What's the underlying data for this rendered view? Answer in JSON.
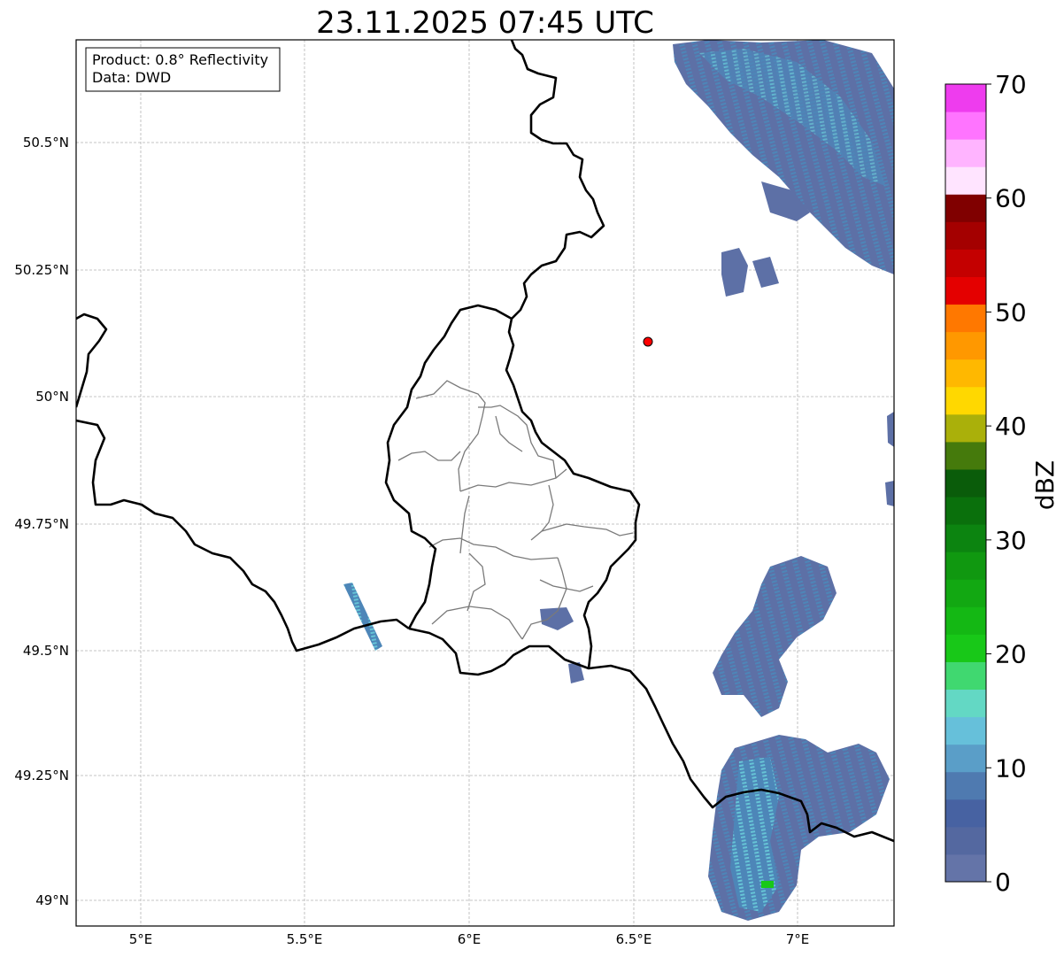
{
  "title": "23.11.2025 07:45 UTC",
  "info_box": {
    "product": "Product: 0.8° Reflectivity",
    "data": "Data: DWD"
  },
  "axes": {
    "lon_ticks": [
      "5°E",
      "5.5°E",
      "6°E",
      "6.5°E",
      "7°E"
    ],
    "lat_ticks": [
      "50.5°N",
      "50.25°N",
      "50°N",
      "49.75°N",
      "49.5°N",
      "49.25°N",
      "49°N"
    ]
  },
  "colorbar": {
    "label": "dBZ",
    "ticks": [
      "0",
      "10",
      "20",
      "30",
      "40",
      "50",
      "60",
      "70"
    ],
    "colors": [
      "#6474a8",
      "#5468a0",
      "#4762a2",
      "#4f7ab0",
      "#5a9ec8",
      "#66c0da",
      "#63d8c4",
      "#40d870",
      "#18c818",
      "#14b814",
      "#12a812",
      "#109810",
      "#0c8410",
      "#0a700c",
      "#0a5c0a",
      "#457a0c",
      "#aab00a",
      "#ffd800",
      "#ffb800",
      "#ff9800",
      "#ff7800",
      "#e40000",
      "#c40000",
      "#a40000",
      "#800000",
      "#ffe4ff",
      "#ffb4ff",
      "#ff74ff",
      "#ee3cee"
    ]
  },
  "colors": {
    "echo_weak": "#5d70a6",
    "echo_mid": "#4d86b8",
    "echo_light": "#66c4d6",
    "echo_strong": "#18c818",
    "radar_site": "#ff0000",
    "border": "#000000",
    "district": "#7a7a7a",
    "grid": "#b0b0b0"
  }
}
